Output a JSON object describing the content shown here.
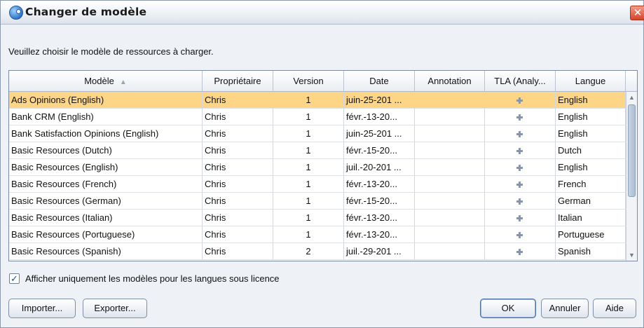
{
  "window": {
    "title": "Changer de modèle"
  },
  "instruction": "Veuillez choisir le modèle de ressources à charger.",
  "table": {
    "columns": [
      "Modèle",
      "Propriétaire",
      "Version",
      "Date",
      "Annotation",
      "TLA (Analy...",
      "Langue"
    ],
    "sorted_column": "Modèle",
    "rows": [
      {
        "model": "Ads Opinions (English)",
        "owner": "Chris",
        "version": "1",
        "date": "juin-25-201 ...",
        "annotation": "",
        "language": "English"
      },
      {
        "model": "Bank CRM (English)",
        "owner": "Chris",
        "version": "1",
        "date": "févr.-13-20...",
        "annotation": "",
        "language": "English"
      },
      {
        "model": "Bank Satisfaction Opinions (English)",
        "owner": "Chris",
        "version": "1",
        "date": "juin-25-201 ...",
        "annotation": "",
        "language": "English"
      },
      {
        "model": "Basic Resources (Dutch)",
        "owner": "Chris",
        "version": "1",
        "date": "févr.-15-20...",
        "annotation": "",
        "language": "Dutch"
      },
      {
        "model": "Basic Resources (English)",
        "owner": "Chris",
        "version": "1",
        "date": "juil.-20-201 ...",
        "annotation": "",
        "language": "English"
      },
      {
        "model": "Basic Resources (French)",
        "owner": "Chris",
        "version": "1",
        "date": "févr.-13-20...",
        "annotation": "",
        "language": "French"
      },
      {
        "model": "Basic Resources (German)",
        "owner": "Chris",
        "version": "1",
        "date": "févr.-15-20...",
        "annotation": "",
        "language": "German"
      },
      {
        "model": "Basic Resources (Italian)",
        "owner": "Chris",
        "version": "1",
        "date": "févr.-13-20...",
        "annotation": "",
        "language": "Italian"
      },
      {
        "model": "Basic Resources (Portuguese)",
        "owner": "Chris",
        "version": "1",
        "date": "févr.-13-20...",
        "annotation": "",
        "language": "Portuguese"
      },
      {
        "model": "Basic Resources (Spanish)",
        "owner": "Chris",
        "version": "2",
        "date": "juil.-29-201 ...",
        "annotation": "",
        "language": "Spanish"
      }
    ],
    "selected_row": 0
  },
  "checkbox": {
    "label": "Afficher uniquement les modèles pour les langues sous licence",
    "checked": true
  },
  "buttons": {
    "import": "Importer...",
    "export": "Exporter...",
    "ok": "OK",
    "cancel": "Annuler",
    "help": "Aide"
  },
  "colors": {
    "selection": "#fcd587",
    "accent": "#1c4f91"
  },
  "icons": {
    "app": "app-resource-icon",
    "close": "close-icon",
    "tla": "tla-grid-icon",
    "sort": "sort-ascending-icon"
  }
}
